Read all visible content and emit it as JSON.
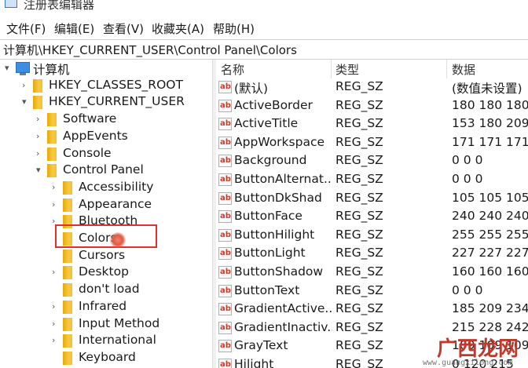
{
  "window": {
    "title": "注册表编辑器"
  },
  "menu": {
    "items": [
      "文件(F)",
      "编辑(E)",
      "查看(V)",
      "收藏夹(A)",
      "帮助(H)"
    ]
  },
  "address": {
    "path": "计算机\\HKEY_CURRENT_USER\\Control Panel\\Colors"
  },
  "tree": {
    "items": [
      {
        "label": "计算机",
        "expander": "▾"
      },
      {
        "label": "HKEY_CLASSES_ROOT",
        "expander": "›"
      },
      {
        "label": "HKEY_CURRENT_USER",
        "expander": "▾"
      },
      {
        "label": "Software",
        "expander": "›"
      },
      {
        "label": "AppEvents",
        "expander": "›"
      },
      {
        "label": "Console",
        "expander": "›"
      },
      {
        "label": "Control Panel",
        "expander": "▾"
      },
      {
        "label": "Accessibility",
        "expander": "›"
      },
      {
        "label": "Appearance",
        "expander": "›"
      },
      {
        "label": "Bluetooth",
        "expander": "›"
      },
      {
        "label": "Colors",
        "expander": ""
      },
      {
        "label": "Cursors",
        "expander": ""
      },
      {
        "label": "Desktop",
        "expander": "›"
      },
      {
        "label": "don't load",
        "expander": ""
      },
      {
        "label": "Infrared",
        "expander": "›"
      },
      {
        "label": "Input Method",
        "expander": "›"
      },
      {
        "label": "International",
        "expander": "›"
      },
      {
        "label": "Keyboard",
        "expander": ""
      }
    ]
  },
  "list": {
    "headers": {
      "name": "名称",
      "type": "类型",
      "data": "数据"
    },
    "rows": [
      {
        "name": "(默认)",
        "type": "REG_SZ",
        "data": "(数值未设置)"
      },
      {
        "name": "ActiveBorder",
        "type": "REG_SZ",
        "data": "180 180 180"
      },
      {
        "name": "ActiveTitle",
        "type": "REG_SZ",
        "data": "153 180 209"
      },
      {
        "name": "AppWorkspace",
        "type": "REG_SZ",
        "data": "171 171 171"
      },
      {
        "name": "Background",
        "type": "REG_SZ",
        "data": "0 0 0"
      },
      {
        "name": "ButtonAlternat...",
        "type": "REG_SZ",
        "data": "0 0 0"
      },
      {
        "name": "ButtonDkShad",
        "type": "REG_SZ",
        "data": "105 105 105"
      },
      {
        "name": "ButtonFace",
        "type": "REG_SZ",
        "data": "240 240 240"
      },
      {
        "name": "ButtonHilight",
        "type": "REG_SZ",
        "data": "255 255 255"
      },
      {
        "name": "ButtonLight",
        "type": "REG_SZ",
        "data": "227 227 227"
      },
      {
        "name": "ButtonShadow",
        "type": "REG_SZ",
        "data": "160 160 160"
      },
      {
        "name": "ButtonText",
        "type": "REG_SZ",
        "data": "0 0 0"
      },
      {
        "name": "GradientActive...",
        "type": "REG_SZ",
        "data": "185 209 234"
      },
      {
        "name": "GradientInactiv...",
        "type": "REG_SZ",
        "data": "215 228 242"
      },
      {
        "name": "GrayText",
        "type": "REG_SZ",
        "data": "109 109 109"
      },
      {
        "name": "Hilight",
        "type": "REG_SZ",
        "data": "0 120 215"
      }
    ],
    "value_icon_text": "ab"
  },
  "watermark": {
    "brand": "广西龙网",
    "url": "www.guangxilong.com"
  },
  "colors": {
    "folder": "#f3c037",
    "highlight_box": "#e03030",
    "watermark": "#c0392b"
  }
}
